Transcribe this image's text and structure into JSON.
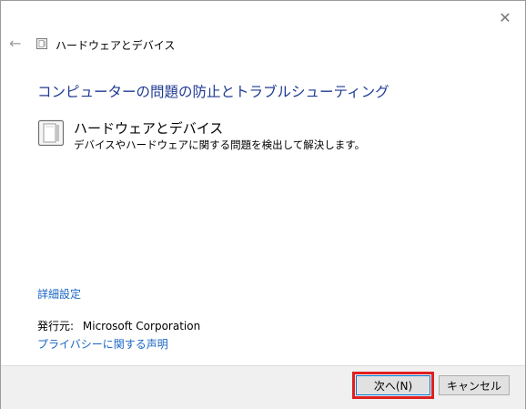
{
  "window": {
    "title": "ハードウェアとデバイス",
    "close_glyph": "✕",
    "back_glyph": "←"
  },
  "main": {
    "heading": "コンピューターの問題の防止とトラブルシューティング",
    "item": {
      "title": "ハードウェアとデバイス",
      "description": "デバイスやハードウェアに関する問題を検出して解決します。",
      "icon": "device-icon"
    },
    "advanced_link": "詳細設定",
    "publisher_label": "発行元:",
    "publisher_name": "Microsoft Corporation",
    "privacy_link": "プライバシーに関する声明"
  },
  "footer": {
    "next_label": "次へ(N)",
    "cancel_label": "キャンセル"
  },
  "colors": {
    "heading": "#1f3a93",
    "link": "#1a66c2",
    "highlight": "#e02020"
  }
}
